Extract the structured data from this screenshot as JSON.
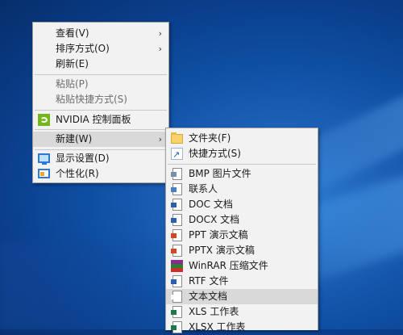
{
  "context_menu": {
    "items": [
      {
        "label": "查看(V)",
        "arrow": "›"
      },
      {
        "label": "排序方式(O)",
        "arrow": "›"
      },
      {
        "label": "刷新(E)"
      },
      {
        "label": "粘贴(P)"
      },
      {
        "label": "粘贴快捷方式(S)"
      },
      {
        "label": "NVIDIA 控制面板",
        "icon": "nvidia-icon"
      },
      {
        "label": "新建(W)",
        "arrow": "›"
      },
      {
        "label": "显示设置(D)",
        "icon": "display-icon"
      },
      {
        "label": "个性化(R)",
        "icon": "personalize-icon"
      }
    ]
  },
  "new_submenu": {
    "items": [
      {
        "label": "文件夹(F)",
        "icon": "folder-icon"
      },
      {
        "label": "快捷方式(S)",
        "icon": "shortcut-icon"
      },
      {
        "label": "BMP 图片文件",
        "icon": "bmp-file-icon"
      },
      {
        "label": "联系人",
        "icon": "contact-icon"
      },
      {
        "label": "DOC 文档",
        "icon": "doc-file-icon"
      },
      {
        "label": "DOCX 文档",
        "icon": "docx-file-icon"
      },
      {
        "label": "PPT 演示文稿",
        "icon": "ppt-file-icon"
      },
      {
        "label": "PPTX 演示文稿",
        "icon": "pptx-file-icon"
      },
      {
        "label": "WinRAR 压缩文件",
        "icon": "winrar-icon"
      },
      {
        "label": "RTF 文件",
        "icon": "rtf-file-icon"
      },
      {
        "label": "文本文档",
        "icon": "text-file-icon"
      },
      {
        "label": "XLS 工作表",
        "icon": "xls-file-icon"
      },
      {
        "label": "XLSX 工作表",
        "icon": "xlsx-file-icon"
      }
    ]
  },
  "colors": {
    "hover": "#d9d9d9",
    "disabled_text": "#6d6d6d",
    "menu_bg": "#f2f2f2"
  }
}
